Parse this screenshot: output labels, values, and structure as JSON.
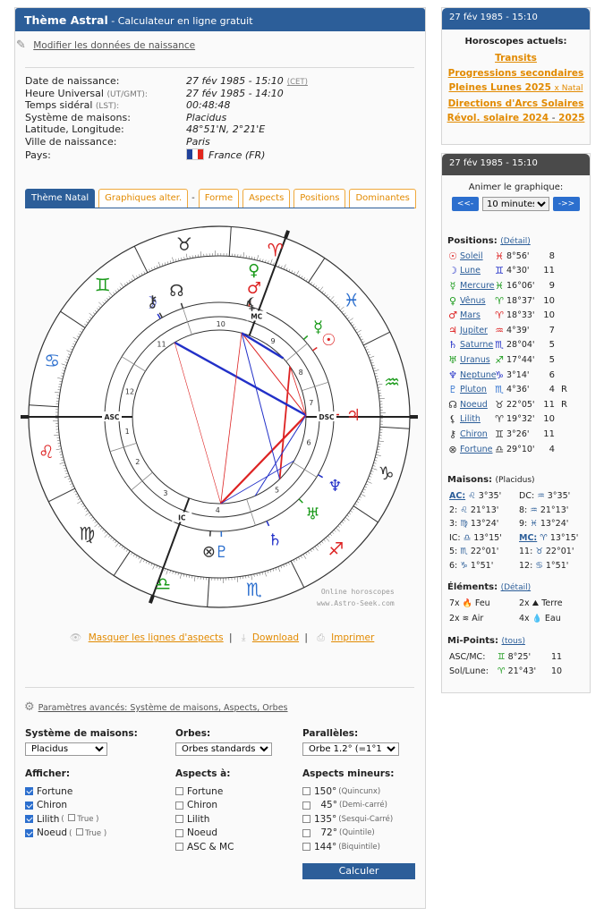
{
  "header": {
    "title": "Thème Astral",
    "subtitle": " - Calculateur en ligne gratuit"
  },
  "edit_link": "Modifier les données de naissance",
  "birth": {
    "rows": [
      {
        "label": "Date de naissance:",
        "value": "27 fév 1985 - 15:10",
        "extra": "(CET)"
      },
      {
        "label": "Heure Universal",
        "label_small": "(UT/GMT):",
        "value": "27 fév 1985 - 14:10"
      },
      {
        "label": "Temps sidéral",
        "label_small": "(LST):",
        "value": "00:48:48"
      },
      {
        "label": "Système de maisons:",
        "value": "Placidus"
      },
      {
        "label": "Latitude, Longitude:",
        "value": "48°51'N, 2°21'E"
      },
      {
        "label": "Ville de naissance:",
        "value": "Paris"
      },
      {
        "label": "Pays:",
        "value": "France (FR)"
      }
    ]
  },
  "tabs": [
    "Thème Natal",
    "Graphiques alter.",
    "-",
    "Forme",
    "Aspects",
    "Positions",
    "Dominantes"
  ],
  "chart_labels": {
    "asc": "ASC",
    "dsc": "DSC",
    "mc": "MC",
    "ic": "IC",
    "houses": [
      "1",
      "2",
      "3",
      "4",
      "5",
      "6",
      "7",
      "8",
      "9",
      "10",
      "11",
      "12"
    ]
  },
  "credit": [
    "Online horoscopes",
    "www.Astro-Seek.com"
  ],
  "actions": {
    "hide_lines": "Masquer les lignes d'aspects",
    "download": "Download",
    "print": "Imprimer"
  },
  "advanced": "Paramètres avancés: Système de maisons, Aspects, Orbes",
  "settings": {
    "house_system": {
      "label": "Système de maisons:",
      "value": "Placidus"
    },
    "orbs": {
      "label": "Orbes:",
      "value": "Orbes standards"
    },
    "parallels": {
      "label": "Parallèles:",
      "value": "Orbe 1.2° (=1°12')"
    },
    "show": {
      "label": "Afficher:",
      "items": [
        "Fortune",
        "Chiron",
        "Lilith",
        "Noeud"
      ],
      "true_label": "True"
    },
    "aspects_to": {
      "label": "Aspects à:",
      "items": [
        "Fortune",
        "Chiron",
        "Lilith",
        "Noeud",
        "ASC & MC"
      ]
    },
    "minor": {
      "label": "Aspects mineurs:",
      "items": [
        {
          "deg": "150°",
          "name": "(Quincunx)"
        },
        {
          "deg": "45°",
          "name": "(Demi-carré)"
        },
        {
          "deg": "135°",
          "name": "(Sesqui-Carré)"
        },
        {
          "deg": "72°",
          "name": "(Quintile)"
        },
        {
          "deg": "144°",
          "name": "(Biquintile)"
        }
      ]
    },
    "submit": "Calculer"
  },
  "side1": {
    "head": "27 fév 1985 - 15:10",
    "title": "Horoscopes actuels:",
    "links": [
      "Transits",
      "Progressions secondaires",
      "Pleines Lunes 2025",
      "x Natal",
      "Directions d'Arcs Solaires",
      "Révol. solaire 2024",
      "-",
      "2025"
    ]
  },
  "side2": {
    "head": "27 fév 1985 - 15:10",
    "animate": "Animer le graphique:",
    "prev": "<<-",
    "next": "->>",
    "interval": "10 minutes",
    "positions_label": "Positions:",
    "detail": "(Détail)",
    "planets": [
      {
        "glyph": "☉",
        "name": "Soleil",
        "sign": "♓",
        "deg": "8°56'",
        "house": "8",
        "retro": "",
        "color": "#d22"
      },
      {
        "glyph": "☽",
        "name": "Lune",
        "sign": "♊",
        "deg": "4°30'",
        "house": "11",
        "retro": "",
        "color": "#2230c8"
      },
      {
        "glyph": "☿",
        "name": "Mercure",
        "sign": "♓",
        "deg": "16°06'",
        "house": "9",
        "retro": "",
        "color": "#1a9a1a"
      },
      {
        "glyph": "♀",
        "name": "Vênus",
        "sign": "♈",
        "deg": "18°37'",
        "house": "10",
        "retro": "",
        "color": "#1a9a1a"
      },
      {
        "glyph": "♂",
        "name": "Mars",
        "sign": "♈",
        "deg": "18°33'",
        "house": "10",
        "retro": "",
        "color": "#d22"
      },
      {
        "glyph": "♃",
        "name": "Jupiter",
        "sign": "♒",
        "deg": "4°39'",
        "house": "7",
        "retro": "",
        "color": "#d22"
      },
      {
        "glyph": "♄",
        "name": "Saturne",
        "sign": "♏",
        "deg": "28°04'",
        "house": "5",
        "retro": "",
        "color": "#2230c8"
      },
      {
        "glyph": "♅",
        "name": "Uranus",
        "sign": "♐",
        "deg": "17°44'",
        "house": "5",
        "retro": "",
        "color": "#1a9a1a"
      },
      {
        "glyph": "♆",
        "name": "Neptune",
        "sign": "♑",
        "deg": "3°14'",
        "house": "6",
        "retro": "",
        "color": "#2230c8"
      },
      {
        "glyph": "♇",
        "name": "Pluton",
        "sign": "♏",
        "deg": "4°36'",
        "house": "4",
        "retro": "R",
        "color": "#2c6fce"
      },
      {
        "glyph": "☊",
        "name": "Noeud",
        "sign": "♉",
        "deg": "22°05'",
        "house": "11",
        "retro": "R",
        "color": "#333"
      },
      {
        "glyph": "⚸",
        "name": "Lilith",
        "sign": "♈",
        "deg": "19°32'",
        "house": "10",
        "retro": "",
        "color": "#333"
      },
      {
        "glyph": "⚷",
        "name": "Chiron",
        "sign": "♊",
        "deg": "3°26'",
        "house": "11",
        "retro": "",
        "color": "#333"
      },
      {
        "glyph": "⊗",
        "name": "Fortune",
        "sign": "♎",
        "deg": "29°10'",
        "house": "4",
        "retro": "",
        "color": "#333"
      }
    ],
    "houses_label": "Maisons:",
    "houses_system": "(Placidus)",
    "houses": [
      [
        "AC:",
        "♌",
        "3°35'",
        "DC:",
        "♒",
        "3°35'"
      ],
      [
        "2:",
        "♌",
        "21°13'",
        "8:",
        "♒",
        "21°13'"
      ],
      [
        "3:",
        "♍",
        "13°24'",
        "9:",
        "♓",
        "13°24'"
      ],
      [
        "IC:",
        "♎",
        "13°15'",
        "MC:",
        "♈",
        "13°15'"
      ],
      [
        "5:",
        "♏",
        "22°01'",
        "11:",
        "♉",
        "22°01'"
      ],
      [
        "6:",
        "♑",
        "1°51'",
        "12:",
        "♋",
        "1°51'"
      ]
    ],
    "elements_label": "Éléments:",
    "elements": [
      [
        "7x",
        "🔥",
        "Feu",
        "2x",
        "⛰",
        "Terre"
      ],
      [
        "2x",
        "≋",
        "Air",
        "4x",
        "💧",
        "Eau"
      ]
    ],
    "midpoints_label": "Mi-Points:",
    "midpoints_link": "(tous)",
    "midpoints": [
      [
        "ASC/MC:",
        "♊",
        "8°25'",
        "11"
      ],
      [
        "Sol/Lune:",
        "♈",
        "21°43'",
        "10"
      ]
    ]
  }
}
